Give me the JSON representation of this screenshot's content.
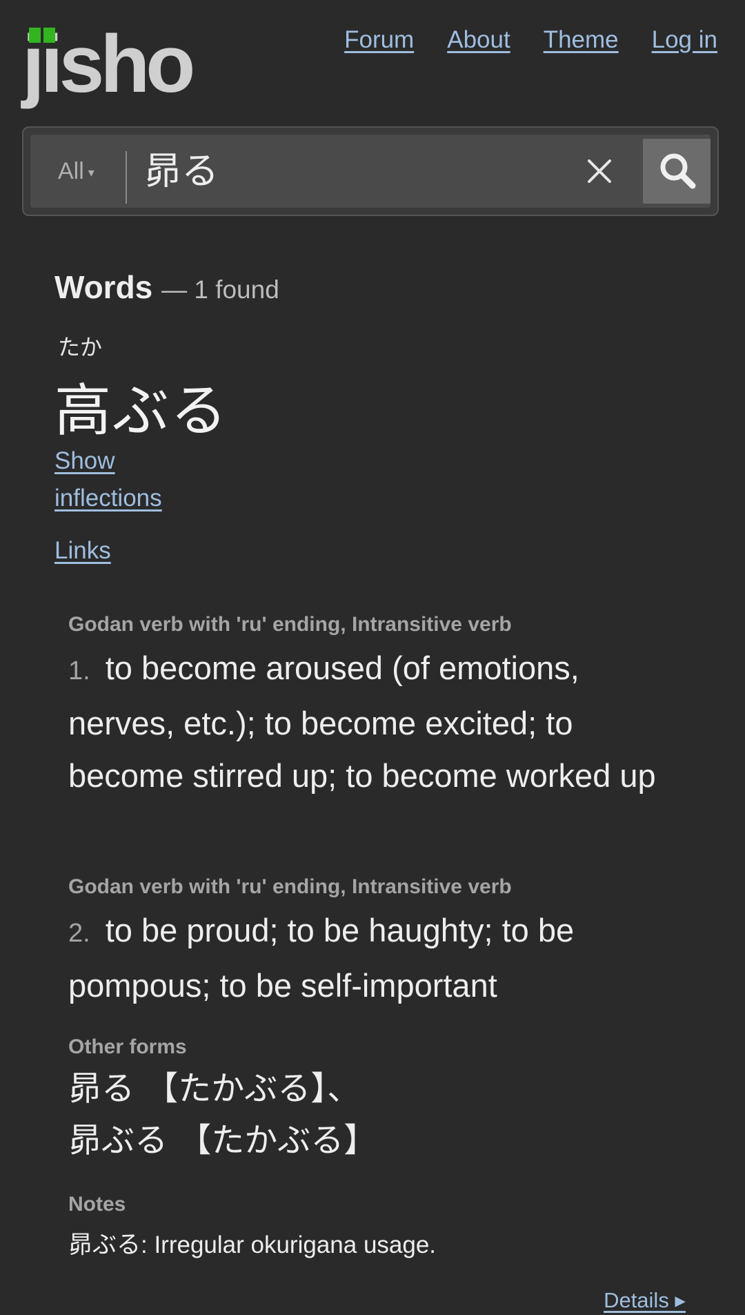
{
  "header": {
    "logo_text": "jisho",
    "nav": [
      "Forum",
      "About",
      "Theme",
      "Log in"
    ],
    "brand_green": "#32b51f"
  },
  "search": {
    "type_label": "All",
    "query": "昴る",
    "clear_icon": "close-icon",
    "search_icon": "search-icon"
  },
  "results": {
    "section_title": "Words",
    "count_text": "— 1 found",
    "entry": {
      "furigana": "たか",
      "word": "高ぶる",
      "show_inflections_line1": "Show",
      "show_inflections_line2": "inflections",
      "links_label": "Links",
      "senses": [
        {
          "tags": "Godan verb with 'ru' ending, Intransitive verb",
          "number": "1.",
          "meaning": "to become aroused (of emotions, nerves, etc.); to become excited; to become stirred up; to become worked up"
        },
        {
          "tags": "Godan verb with 'ru' ending, Intransitive verb",
          "number": "2.",
          "meaning": "to be proud; to be haughty; to be pompous; to be self-important"
        }
      ],
      "other_forms_label": "Other forms",
      "other_forms_line1": "昴る 【たかぶる】、",
      "other_forms_line2": "昴ぶる 【たかぶる】",
      "notes_label": "Notes",
      "notes_text": "昴ぶる: Irregular okurigana usage.",
      "details_label": "Details ▸"
    }
  }
}
